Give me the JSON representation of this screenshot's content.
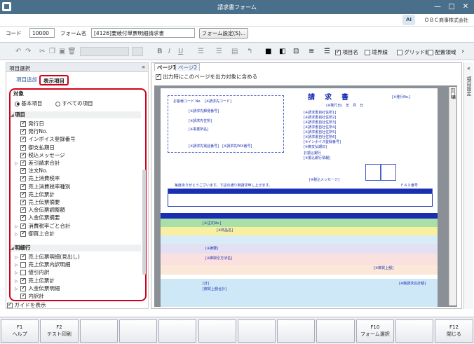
{
  "window": {
    "title": "請求書フォーム",
    "company": "ＯＢＣ商事株式会社",
    "ai_label": "AI"
  },
  "form": {
    "code_label": "コード",
    "code_value": "10000",
    "name_label": "フォーム名",
    "name_value": "[4126]要綾付単票明細請求書",
    "settings_button": "フォーム設定(S)..."
  },
  "toolbar": {
    "item_name": "項目名",
    "border": "境界線",
    "grid": "グリッド線",
    "layout_area": "配置領域"
  },
  "left_panel": {
    "header": "項目選択",
    "tab_add": "項目追加",
    "tab_show": "表示項目",
    "target": "対象",
    "radio_basic": "基本項目",
    "radio_all": "すべての項目",
    "section_items": "項目",
    "section_detail": "明細行",
    "guide": "ガイドを表示",
    "items": [
      {
        "label": "発行日",
        "checked": true,
        "expand": false
      },
      {
        "label": "発行No.",
        "checked": true,
        "expand": false
      },
      {
        "label": "インボイス登録番号",
        "checked": true,
        "expand": false
      },
      {
        "label": "御支払期日",
        "checked": true,
        "expand": false
      },
      {
        "label": "税込メッセージ",
        "checked": true,
        "expand": false
      },
      {
        "label": "差引請求合計",
        "checked": true,
        "expand": true
      },
      {
        "label": "注文No.",
        "checked": true,
        "expand": false
      },
      {
        "label": "売上消費税率",
        "checked": true,
        "expand": false
      },
      {
        "label": "売上消費税率種別",
        "checked": true,
        "expand": false
      },
      {
        "label": "売上伝票計",
        "checked": true,
        "expand": false
      },
      {
        "label": "売上伝票摘要",
        "checked": true,
        "expand": false
      },
      {
        "label": "入金伝票調整額",
        "checked": true,
        "expand": false
      },
      {
        "label": "入金伝票摘要",
        "checked": true,
        "expand": false
      },
      {
        "label": "消費税率ごと合計",
        "checked": true,
        "expand": true
      },
      {
        "label": "御買上合計",
        "checked": true,
        "expand": true
      }
    ],
    "detail": [
      {
        "label": "売上伝票明細(見出し)",
        "checked": true,
        "expand": true
      },
      {
        "label": "売上伝票内訳明細",
        "checked": false,
        "expand": true
      },
      {
        "label": "値引内訳",
        "checked": false,
        "expand": true
      },
      {
        "label": "売上伝票計",
        "checked": true,
        "expand": true
      },
      {
        "label": "入金伝票明細",
        "checked": true,
        "expand": true
      },
      {
        "label": "内訳計",
        "checked": true,
        "expand": false
      }
    ]
  },
  "right_side": {
    "label": "項目設定"
  },
  "main": {
    "tab1": "ページ1",
    "tab2": "ページ2",
    "print_all": "出力時にこのページを出力対象に含める",
    "thumb": "1面"
  },
  "paper": {
    "title": "請　求　書",
    "issue_no": "[※発行No.]",
    "date_line": "(※発行日)　年　月　日",
    "bank": "お振込銀行",
    "thanks": "毎度ありがとうございます。下記の通り御請求申し上げます。",
    "tax_msg": "[※税込メッセージ]",
    "fax_no": "ＦＡＸ番号"
  },
  "fkeys": [
    {
      "key": "F1",
      "label": "ヘルプ"
    },
    {
      "key": "F2",
      "label": "テスト印刷"
    },
    {
      "key": "",
      "label": ""
    },
    {
      "key": "",
      "label": ""
    },
    {
      "key": "",
      "label": ""
    },
    {
      "key": "",
      "label": ""
    },
    {
      "key": "",
      "label": ""
    },
    {
      "key": "",
      "label": ""
    },
    {
      "key": "",
      "label": ""
    },
    {
      "key": "F10",
      "label": "フォーム選択"
    },
    {
      "key": "",
      "label": ""
    },
    {
      "key": "F12",
      "label": "閉じる"
    }
  ],
  "colors": {
    "accent_red": "#d0021b",
    "titlebar": "#4a6f8a",
    "paper_text": "#1a2fb0"
  }
}
